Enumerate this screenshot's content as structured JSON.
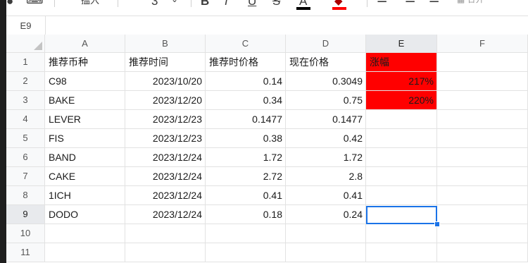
{
  "toolbar": {
    "font_name_fragment": "搵入",
    "font_size_fragment": "3",
    "bold": "B",
    "italic": "I",
    "underline": "U",
    "strike": "S",
    "text_color": "A",
    "fill_color": "◆",
    "fill_bar_color": "#ff0000",
    "text_bar_color": "#000000",
    "merge_fragment": "合并"
  },
  "name_box": "E9",
  "columns": [
    "A",
    "B",
    "C",
    "D",
    "E",
    "F"
  ],
  "rows": [
    "1",
    "2",
    "3",
    "4",
    "5",
    "6",
    "7",
    "8",
    "9",
    "10",
    "11"
  ],
  "header_row": [
    "推荐币种",
    "推荐时间",
    "推荐时价格",
    "现在价格",
    "涨幅"
  ],
  "data_rows": [
    {
      "coin": "C98",
      "date": "2023/10/20",
      "price_then": "0.14",
      "price_now": "0.3049",
      "change": "217%"
    },
    {
      "coin": "BAKE",
      "date": "2023/12/20",
      "price_then": "0.34",
      "price_now": "0.75",
      "change": "220%"
    },
    {
      "coin": "LEVER",
      "date": "2023/12/23",
      "price_then": "0.1477",
      "price_now": "0.1477",
      "change": ""
    },
    {
      "coin": "FIS",
      "date": "2023/12/23",
      "price_then": "0.38",
      "price_now": "0.42",
      "change": ""
    },
    {
      "coin": "BAND",
      "date": "2023/12/24",
      "price_then": "1.72",
      "price_now": "1.72",
      "change": ""
    },
    {
      "coin": "CAKE",
      "date": "2023/12/24",
      "price_then": "2.72",
      "price_now": "2.8",
      "change": ""
    },
    {
      "coin": "1ICH",
      "date": "2023/12/24",
      "price_then": "0.41",
      "price_now": "0.41",
      "change": ""
    },
    {
      "coin": "DODO",
      "date": "2023/12/24",
      "price_then": "0.18",
      "price_now": "0.24",
      "change": ""
    }
  ],
  "colors": {
    "highlight": "#ff0000",
    "selection": "#1a73e8"
  }
}
